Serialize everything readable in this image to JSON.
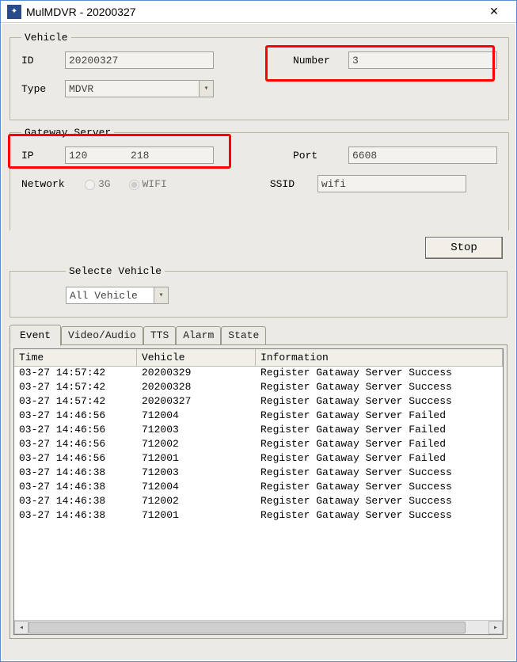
{
  "title": "MulMDVR - 20200327",
  "vehicle": {
    "legend": "Vehicle",
    "id_label": "ID",
    "id_value": "20200327",
    "number_label": "Number",
    "number_value": "3",
    "type_label": "Type",
    "type_value": "MDVR"
  },
  "gateway": {
    "legend": "Gateway Server",
    "ip_label": "IP",
    "ip_value": "120       218",
    "port_label": "Port",
    "port_value": "6608",
    "network_label": "Network",
    "radio_3g": "3G",
    "radio_wifi": "WIFI",
    "ssid_label": "SSID",
    "ssid_value": "wifi"
  },
  "stop_button": "Stop",
  "select_vehicle": {
    "legend": "Selecte Vehicle",
    "value": "All Vehicle"
  },
  "tabs": {
    "event": "Event",
    "video_audio": "Video/Audio",
    "tts": "TTS",
    "alarm": "Alarm",
    "state": "State"
  },
  "grid": {
    "col_time": "Time",
    "col_vehicle": "Vehicle",
    "col_info": "Information",
    "rows": [
      {
        "time": "03-27  14:57:42",
        "vehicle": "20200329",
        "info": "Register Gataway Server Success"
      },
      {
        "time": "03-27  14:57:42",
        "vehicle": "20200328",
        "info": "Register Gataway Server Success"
      },
      {
        "time": "03-27  14:57:42",
        "vehicle": "20200327",
        "info": "Register Gataway Server Success"
      },
      {
        "time": "03-27  14:46:56",
        "vehicle": "712004",
        "info": "Register Gataway Server Failed"
      },
      {
        "time": "03-27  14:46:56",
        "vehicle": "712003",
        "info": "Register Gataway Server Failed"
      },
      {
        "time": "03-27  14:46:56",
        "vehicle": "712002",
        "info": "Register Gataway Server Failed"
      },
      {
        "time": "03-27  14:46:56",
        "vehicle": "712001",
        "info": "Register Gataway Server Failed"
      },
      {
        "time": "03-27  14:46:38",
        "vehicle": "712003",
        "info": "Register Gataway Server Success"
      },
      {
        "time": "03-27  14:46:38",
        "vehicle": "712004",
        "info": "Register Gataway Server Success"
      },
      {
        "time": "03-27  14:46:38",
        "vehicle": "712002",
        "info": "Register Gataway Server Success"
      },
      {
        "time": "03-27  14:46:38",
        "vehicle": "712001",
        "info": "Register Gataway Server Success"
      }
    ]
  }
}
